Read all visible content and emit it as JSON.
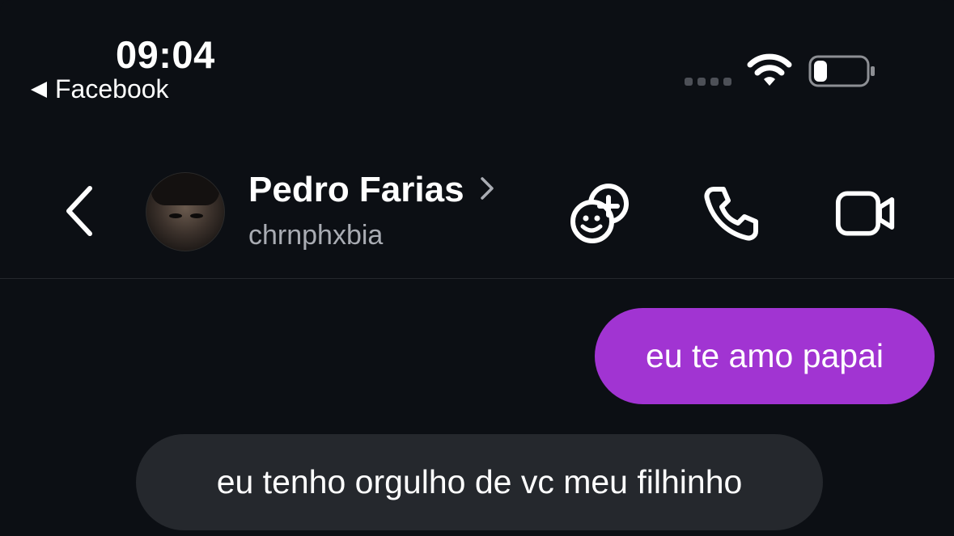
{
  "status_bar": {
    "time": "09:04",
    "back_app_label": "Facebook",
    "wifi_icon": "wifi-icon",
    "battery_icon": "battery-low-icon"
  },
  "header": {
    "contact_name": "Pedro Farias",
    "username": "chrnphxbia",
    "icons": [
      "back-chevron-icon",
      "chevron-right-icon",
      "sticker-add-icon",
      "phone-icon",
      "video-camera-icon"
    ]
  },
  "messages": [
    {
      "direction": "sent",
      "text": "eu te amo papai"
    },
    {
      "direction": "received",
      "text": "eu tenho orgulho de vc meu filhinho"
    }
  ],
  "colors": {
    "background": "#0c0f14",
    "sent_bubble": "#a134d2",
    "received_bubble": "#25282d",
    "username_text": "#a9acb3"
  }
}
